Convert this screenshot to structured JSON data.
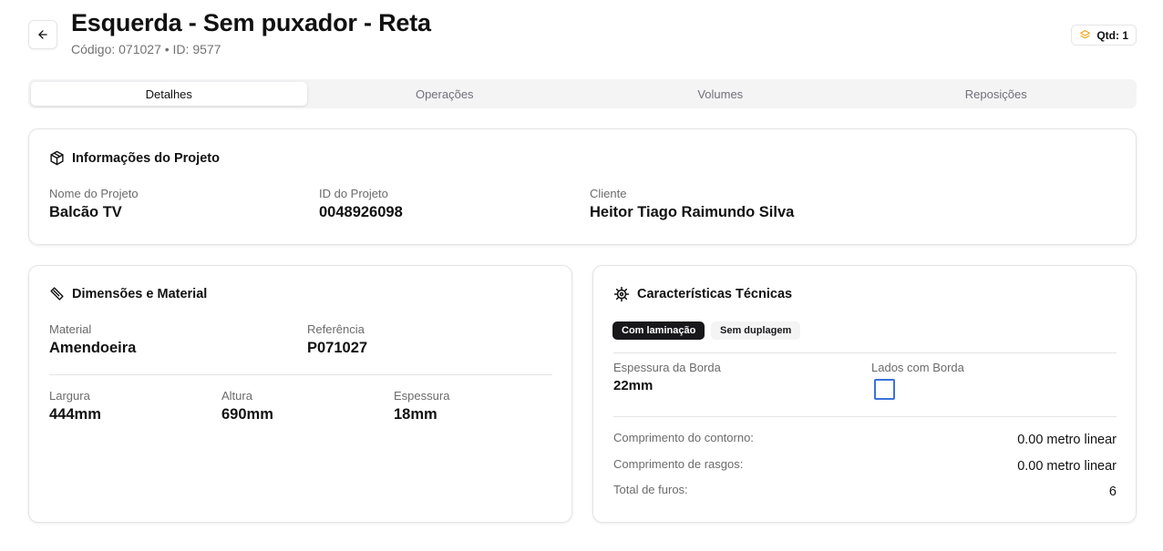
{
  "header": {
    "title": "Esquerda - Sem puxador - Reta",
    "subtitle": "Código: 071027 • ID: 9577",
    "qty_label": "Qtd: 1"
  },
  "tabs": [
    {
      "label": "Detalhes",
      "active": true
    },
    {
      "label": "Operações",
      "active": false
    },
    {
      "label": "Volumes",
      "active": false
    },
    {
      "label": "Reposições",
      "active": false
    }
  ],
  "project_info": {
    "title": "Informações do Projeto",
    "icon": "package-icon",
    "fields": [
      {
        "label": "Nome do Projeto",
        "value": "Balcão TV"
      },
      {
        "label": "ID do Projeto",
        "value": "0048926098"
      },
      {
        "label": "Cliente",
        "value": "Heitor Tiago Raimundo Silva"
      }
    ]
  },
  "dimensions": {
    "title": "Dimensões e Material",
    "icon": "ruler-icon",
    "material": {
      "label": "Material",
      "value": "Amendoeira"
    },
    "reference": {
      "label": "Referência",
      "value": "P071027"
    },
    "width": {
      "label": "Largura",
      "value": "444mm"
    },
    "height": {
      "label": "Altura",
      "value": "690mm"
    },
    "thickness": {
      "label": "Espessura",
      "value": "18mm"
    }
  },
  "technical": {
    "title": "Características Técnicas",
    "icon": "cog-icon",
    "tags": [
      "Com laminação",
      "Sem duplagem"
    ],
    "edge_thickness": {
      "label": "Espessura da Borda",
      "value": "22mm"
    },
    "edge_sides": {
      "label": "Lados com Borda",
      "checked": false
    },
    "metrics": [
      {
        "label": "Comprimento do contorno:",
        "value": "0.00 metro linear"
      },
      {
        "label": "Comprimento de rasgos:",
        "value": "0.00 metro linear"
      },
      {
        "label": "Total de furos:",
        "value": "6"
      }
    ]
  },
  "colors": {
    "accent_orange": "#f59e0b",
    "checkbox_blue": "#3b73d9",
    "chip_dark": "#18181b"
  }
}
